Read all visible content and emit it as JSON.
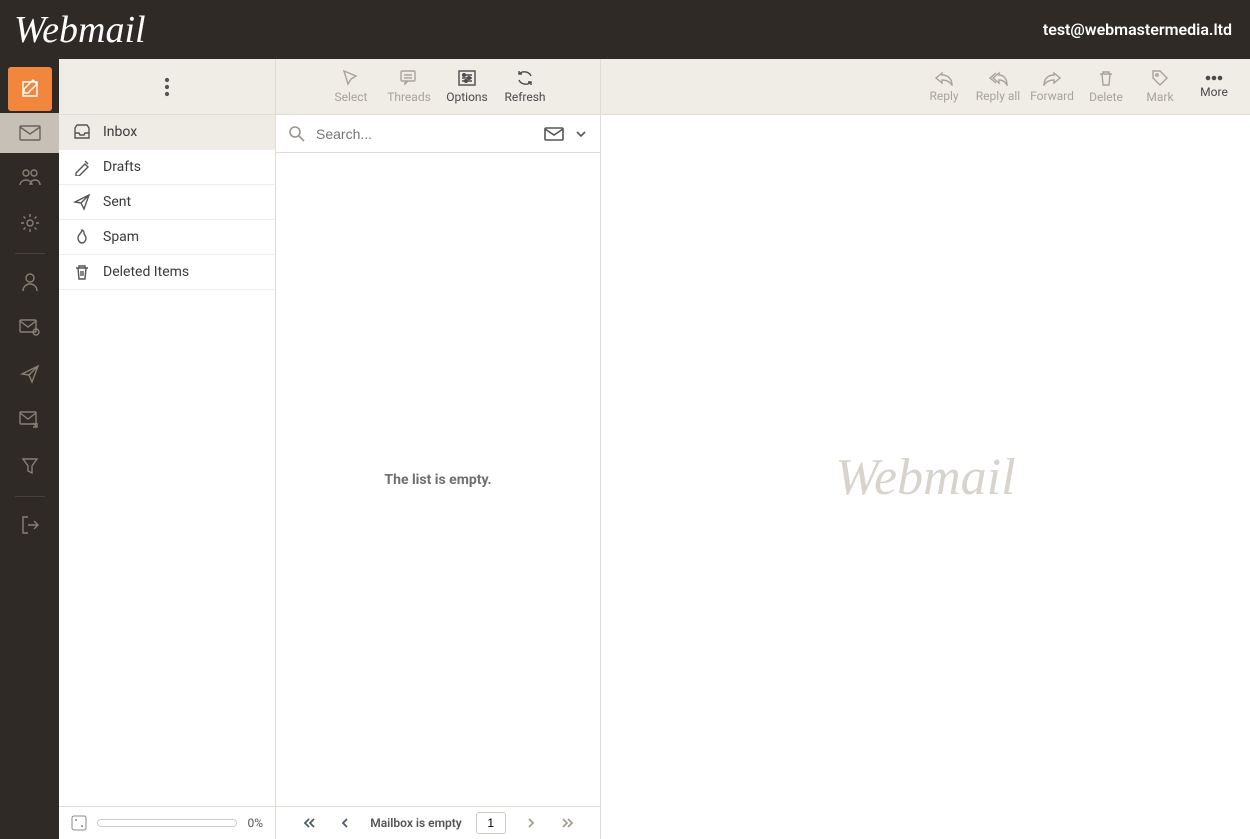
{
  "header": {
    "brand": "Webmail",
    "user": "test@webmastermedia.ltd"
  },
  "folders": {
    "items": [
      {
        "label": "Inbox"
      },
      {
        "label": "Drafts"
      },
      {
        "label": "Sent"
      },
      {
        "label": "Spam"
      },
      {
        "label": "Deleted Items"
      }
    ],
    "quota_percent": "0%"
  },
  "list_toolbar": {
    "select": "Select",
    "threads": "Threads",
    "options": "Options",
    "refresh": "Refresh"
  },
  "search": {
    "placeholder": "Search..."
  },
  "list": {
    "empty": "The list is empty."
  },
  "pager": {
    "status": "Mailbox is empty",
    "page": "1"
  },
  "preview_toolbar": {
    "reply": "Reply",
    "reply_all": "Reply all",
    "forward": "Forward",
    "delete": "Delete",
    "mark": "Mark",
    "more": "More"
  },
  "preview": {
    "watermark": "Webmail"
  }
}
